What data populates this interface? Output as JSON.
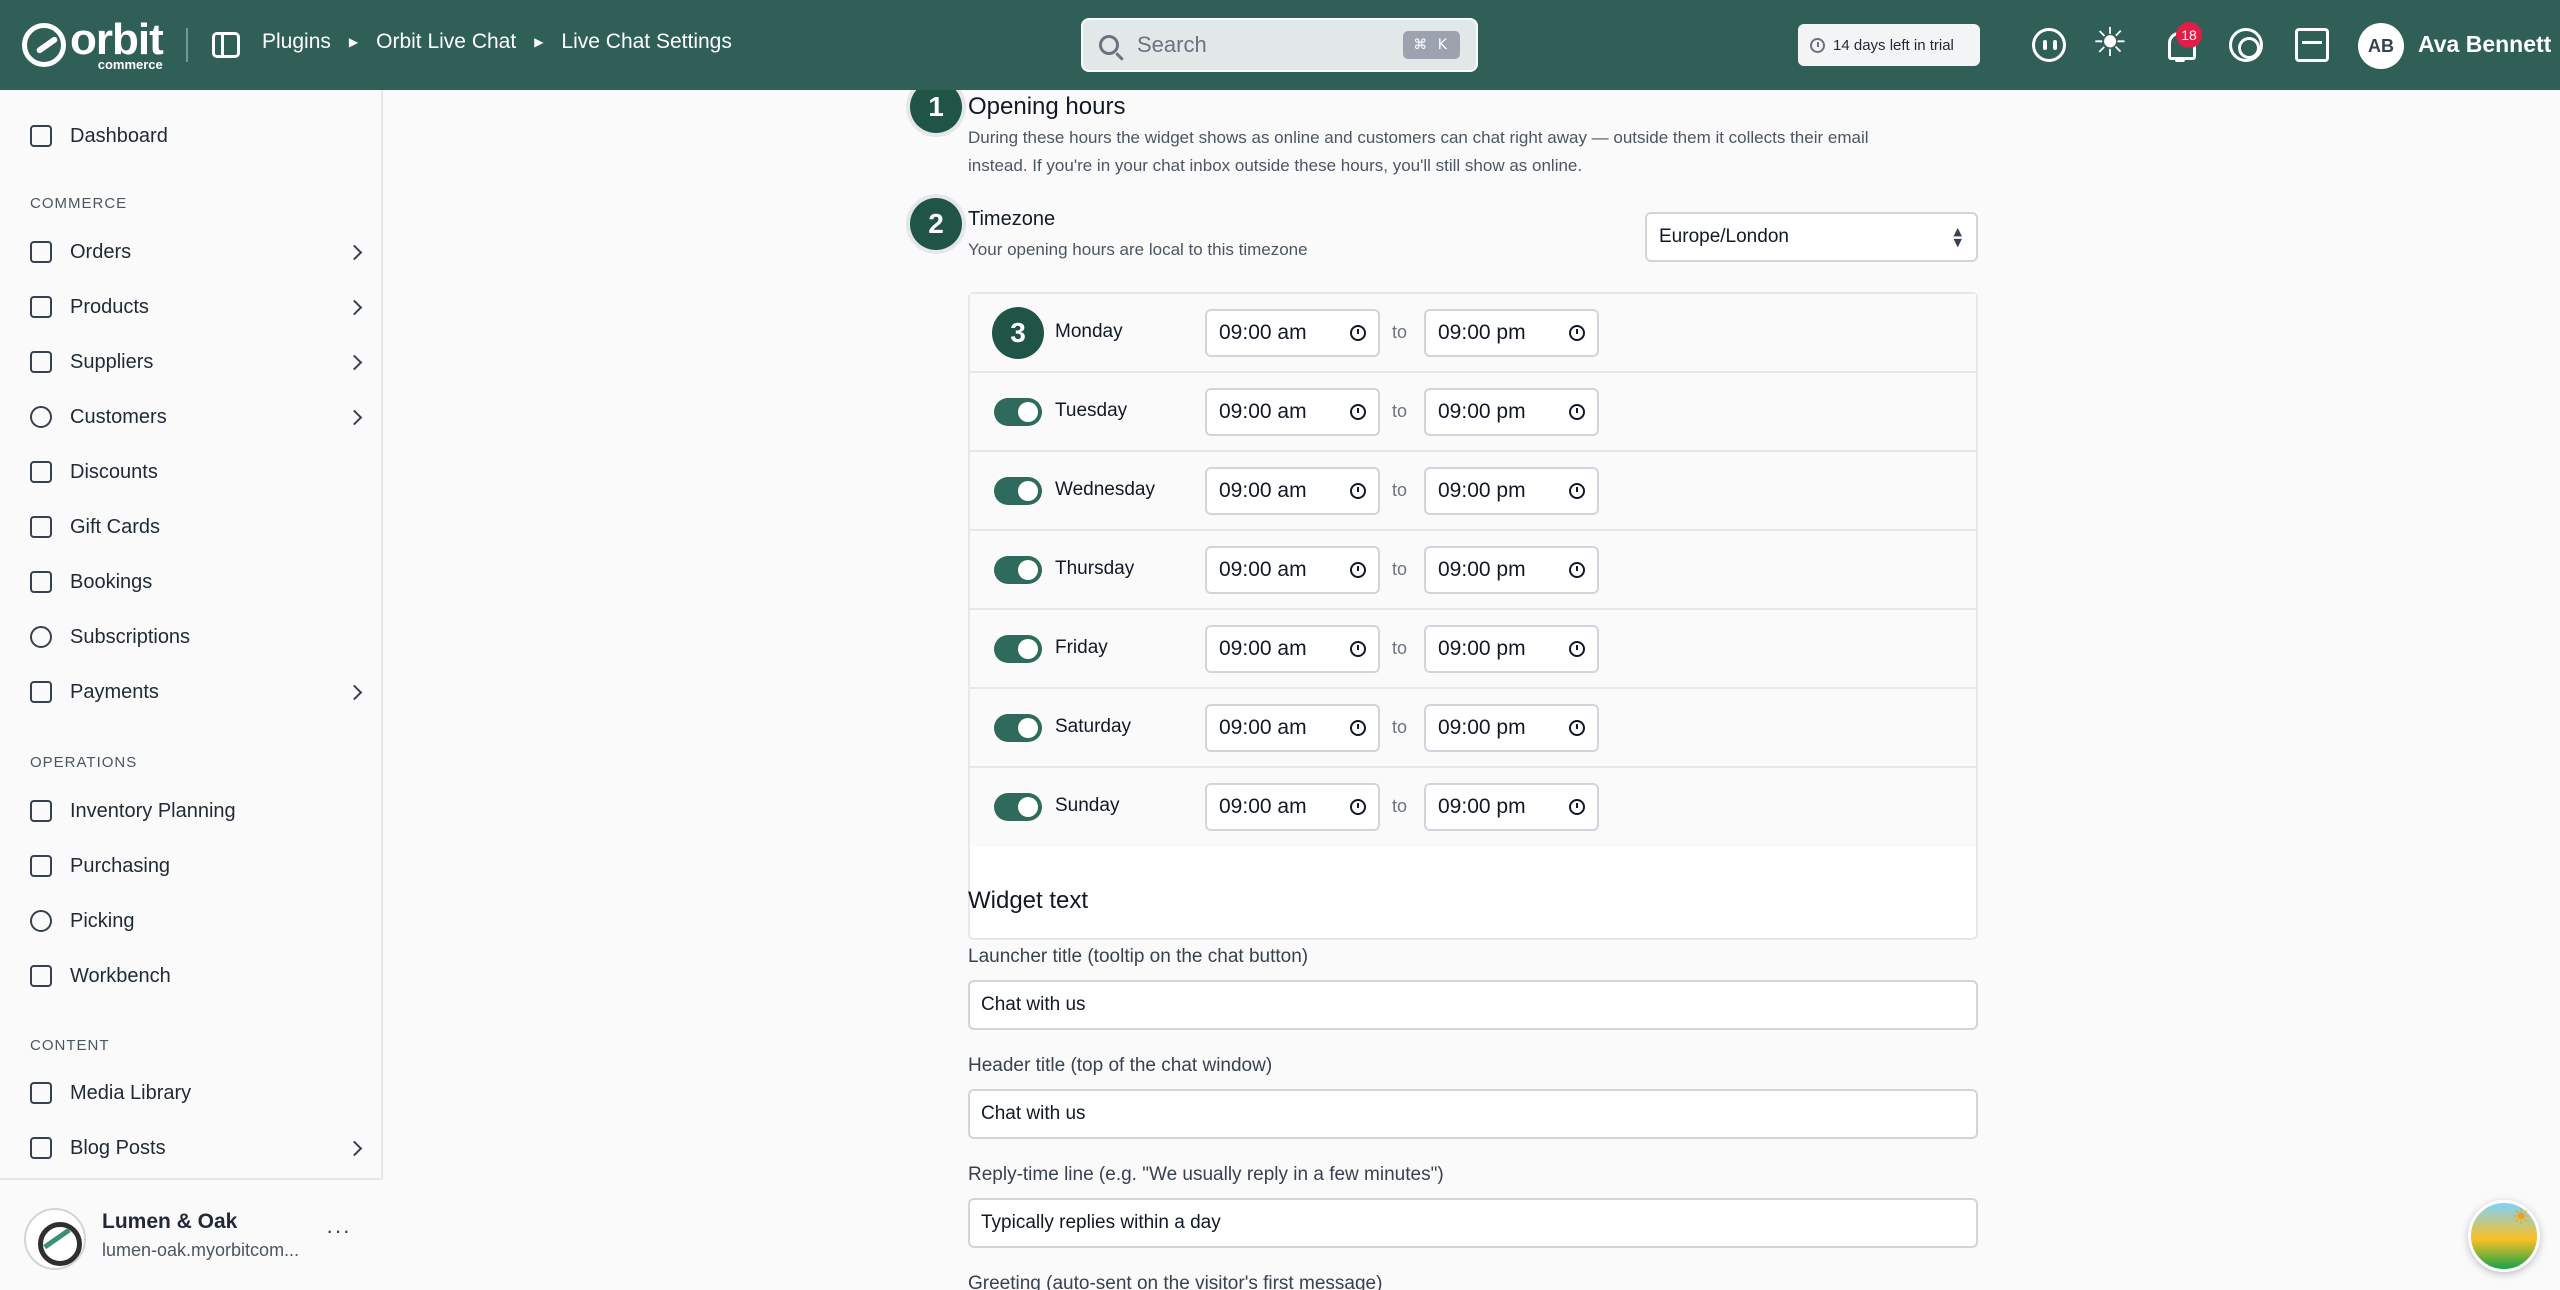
{
  "topbar": {
    "logo_word": "orbit",
    "logo_sub": "commerce",
    "breadcrumbs": [
      "Plugins",
      "Orbit Live Chat",
      "Live Chat Settings"
    ],
    "search_placeholder": "Search",
    "search_shortcut": "⌘ K",
    "trial_text": "14 days left in trial",
    "notification_count": "18",
    "user_initials": "AB",
    "user_name": "Ava Bennett"
  },
  "sidebar": {
    "top_items": [
      {
        "label": "Dashboard",
        "icon": "dashboard-icon"
      }
    ],
    "sections": [
      {
        "label": "COMMERCE",
        "items": [
          {
            "label": "Orders",
            "icon": "orders-icon",
            "chevron": true
          },
          {
            "label": "Products",
            "icon": "box-icon",
            "chevron": true
          },
          {
            "label": "Suppliers",
            "icon": "building-icon",
            "chevron": true
          },
          {
            "label": "Customers",
            "icon": "users-icon",
            "chevron": true
          },
          {
            "label": "Discounts",
            "icon": "tag-icon",
            "chevron": false
          },
          {
            "label": "Gift Cards",
            "icon": "gift-icon",
            "chevron": false
          },
          {
            "label": "Bookings",
            "icon": "calendar-icon",
            "chevron": false
          },
          {
            "label": "Subscriptions",
            "icon": "refresh-icon",
            "chevron": false
          },
          {
            "label": "Payments",
            "icon": "card-icon",
            "chevron": true
          }
        ]
      },
      {
        "label": "OPERATIONS",
        "items": [
          {
            "label": "Inventory Planning",
            "icon": "clipboard-icon",
            "chevron": false
          },
          {
            "label": "Purchasing",
            "icon": "box-icon",
            "chevron": false
          },
          {
            "label": "Picking",
            "icon": "pin-icon",
            "chevron": false
          },
          {
            "label": "Workbench",
            "icon": "box-icon",
            "chevron": false
          }
        ]
      },
      {
        "label": "CONTENT",
        "items": [
          {
            "label": "Media Library",
            "icon": "image-icon",
            "chevron": false
          },
          {
            "label": "Blog Posts",
            "icon": "document-icon",
            "chevron": true
          }
        ]
      }
    ],
    "store": {
      "name": "Lumen & Oak",
      "url": "lumen-oak.myorbitcom...",
      "more": "···"
    }
  },
  "main": {
    "opening_hours": {
      "step": "1",
      "title": "Opening hours",
      "description_line1": "During these hours the widget shows as online and customers can chat right away — outside them it collects their email",
      "description_line2": "instead. If you're in your chat inbox outside these hours, you'll still show as online."
    },
    "timezone": {
      "step": "2",
      "title": "Timezone",
      "description": "Your opening hours are local to this timezone",
      "value": "Europe/London"
    },
    "schedule_step": "3",
    "days": [
      {
        "name": "Monday",
        "enabled": true,
        "open": "09:00 am",
        "close": "09:00 pm"
      },
      {
        "name": "Tuesday",
        "enabled": true,
        "open": "09:00 am",
        "close": "09:00 pm"
      },
      {
        "name": "Wednesday",
        "enabled": true,
        "open": "09:00 am",
        "close": "09:00 pm"
      },
      {
        "name": "Thursday",
        "enabled": true,
        "open": "09:00 am",
        "close": "09:00 pm"
      },
      {
        "name": "Friday",
        "enabled": true,
        "open": "09:00 am",
        "close": "09:00 pm"
      },
      {
        "name": "Saturday",
        "enabled": true,
        "open": "09:00 am",
        "close": "09:00 pm"
      },
      {
        "name": "Sunday",
        "enabled": true,
        "open": "09:00 am",
        "close": "09:00 pm"
      }
    ],
    "to_label": "to",
    "widget_text": {
      "title": "Widget text",
      "launcher_label": "Launcher title (tooltip on the chat button)",
      "launcher_value": "Chat with us",
      "header_label": "Header title (top of the chat window)",
      "header_value": "Chat with us",
      "reply_label": "Reply-time line (e.g. \"We usually reply in a few minutes\")",
      "reply_value": "Typically replies within a day",
      "greeting_label": "Greeting (auto-sent on the visitor's first message)"
    }
  },
  "colors": {
    "topbar": "#2f5f56",
    "accent": "#2f6b5c",
    "step_badge": "#1f5446",
    "notification": "#e11d48"
  }
}
